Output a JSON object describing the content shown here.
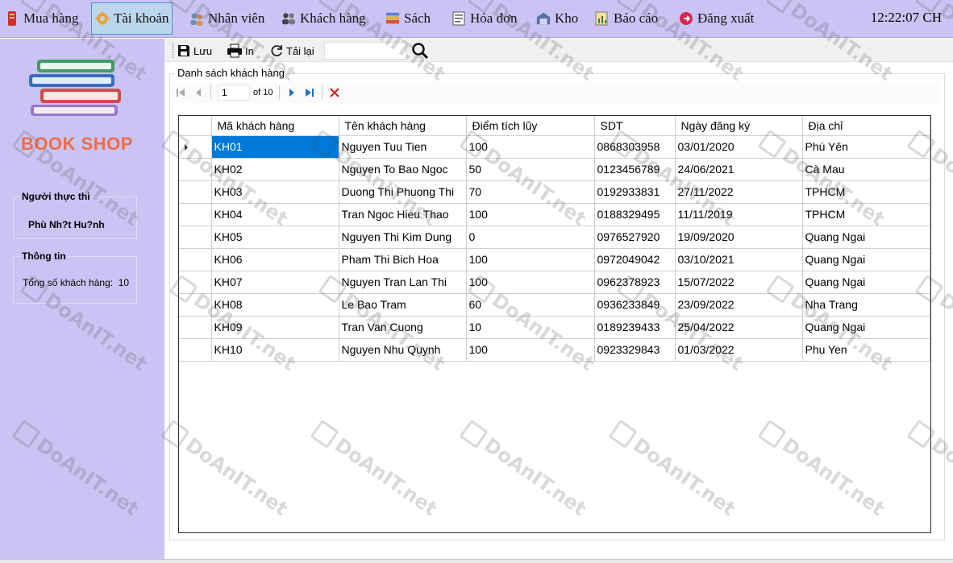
{
  "menu": {
    "items": [
      {
        "label": "Mua hàng",
        "icon": "book-stack-icon"
      },
      {
        "label": "Tài khoản",
        "icon": "gear-user-icon"
      },
      {
        "label": "Nhân viên",
        "icon": "staff-icon"
      },
      {
        "label": "Khách hàng",
        "icon": "customers-icon"
      },
      {
        "label": "Sách",
        "icon": "books-icon"
      },
      {
        "label": "Hóa đơn",
        "icon": "invoice-icon"
      },
      {
        "label": "Kho",
        "icon": "warehouse-icon"
      },
      {
        "label": "Báo cáo",
        "icon": "report-icon"
      },
      {
        "label": "Đăng xuất",
        "icon": "logout-icon"
      }
    ],
    "clock": "12:22:07 CH"
  },
  "sidebar": {
    "logo_text": "BOOK SHOP",
    "executor_title": "Người thực thi",
    "executor_name": "Phù Nh?t Hu?nh",
    "info_title": "Thông tin",
    "info_label": "Tổng số khách hàng:",
    "info_value": "10"
  },
  "toolbar": {
    "save_label": "Lưu",
    "print_label": "In",
    "reload_label": "Tải lại",
    "search_value": ""
  },
  "group": {
    "title": "Danh sách khách hàng"
  },
  "navigator": {
    "position": "1",
    "of_text": "of 10"
  },
  "table": {
    "columns": [
      "Mã khách hàng",
      "Tên khách hàng",
      "Điểm tích lũy",
      "SDT",
      "Ngày đăng ký",
      "Địa chỉ"
    ],
    "rows": [
      [
        "KH01",
        "Nguyen Tuu Tien",
        "100",
        "0868303958",
        "03/01/2020",
        "Phú Yên"
      ],
      [
        "KH02",
        "Nguyen To Bao Ngoc",
        "50",
        "0123456789",
        "24/06/2021",
        "Cà Mau"
      ],
      [
        "KH03",
        "Duong Thi Phuong Thi",
        "70",
        "0192933831",
        "27/11/2022",
        "TPHCM"
      ],
      [
        "KH04",
        "Tran Ngoc Hieu Thao",
        "100",
        "0188329495",
        "11/11/2019",
        "TPHCM"
      ],
      [
        "KH05",
        "Nguyen Thi Kim Dung",
        "0",
        "0976527920",
        "19/09/2020",
        "Quang Ngai"
      ],
      [
        "KH06",
        "Pham Thi Bich Hoa",
        "100",
        "0972049042",
        "03/10/2021",
        "Quang Ngai"
      ],
      [
        "KH07",
        "Nguyen Tran Lan Thi",
        "100",
        "0962378923",
        "15/07/2022",
        "Quang Ngai"
      ],
      [
        "KH08",
        "Le Bao Tram",
        "60",
        "0936233849",
        "23/09/2022",
        "Nha Trang"
      ],
      [
        "KH09",
        "Tran Van Cuong",
        "10",
        "0189239433",
        "25/04/2022",
        "Quang Ngai"
      ],
      [
        "KH10",
        "Nguyen Nhu Quynh",
        "100",
        "0923329843",
        "01/03/2022",
        "Phu Yen"
      ]
    ]
  },
  "watermark": {
    "text": "DoAnIT.net"
  }
}
